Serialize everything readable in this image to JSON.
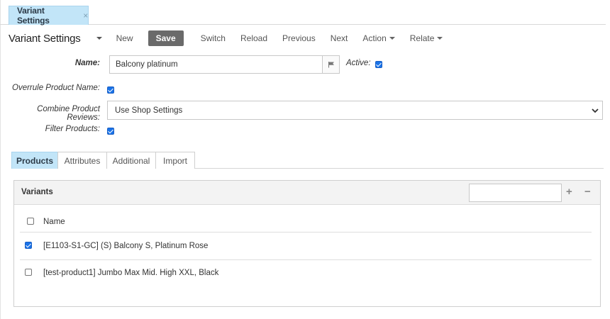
{
  "doc_tab": {
    "label": "Variant Settings",
    "close": "×"
  },
  "toolbar": {
    "title": "Variant Settings",
    "new": "New",
    "save": "Save",
    "switch": "Switch",
    "reload": "Reload",
    "previous": "Previous",
    "next": "Next",
    "action": "Action",
    "relate": "Relate"
  },
  "form": {
    "name_label": "Name:",
    "name_value": "Balcony platinum",
    "active_label": "Active:",
    "active_checked": true,
    "overrule_label": "Overrule Product Name:",
    "overrule_checked": true,
    "combine_label": "Combine Product Reviews:",
    "combine_value": "Use Shop Settings",
    "filter_label": "Filter Products:",
    "filter_checked": true
  },
  "section_tabs": [
    "Products",
    "Attributes",
    "Additional",
    "Import"
  ],
  "active_section_tab": "Products",
  "variants_panel": {
    "title": "Variants",
    "search_value": "",
    "add": "+",
    "remove": "−",
    "column_name": "Name",
    "rows": [
      {
        "name": "[E1103-S1-GC] (S) Balcony S, Platinum Rose",
        "checked": true
      },
      {
        "name": "[test-product1] Jumbo Max Mid. High XXL, Black",
        "checked": false
      }
    ]
  },
  "colors": {
    "tab_active_bg": "#c2e5f8",
    "save_button_bg": "#6a6a6a",
    "checkbox_blue": "#1a73e8"
  },
  "icons": {
    "flag": "flag-icon",
    "dropdown": "chevron-down-icon",
    "add": "plus-icon",
    "remove": "minus-icon"
  }
}
